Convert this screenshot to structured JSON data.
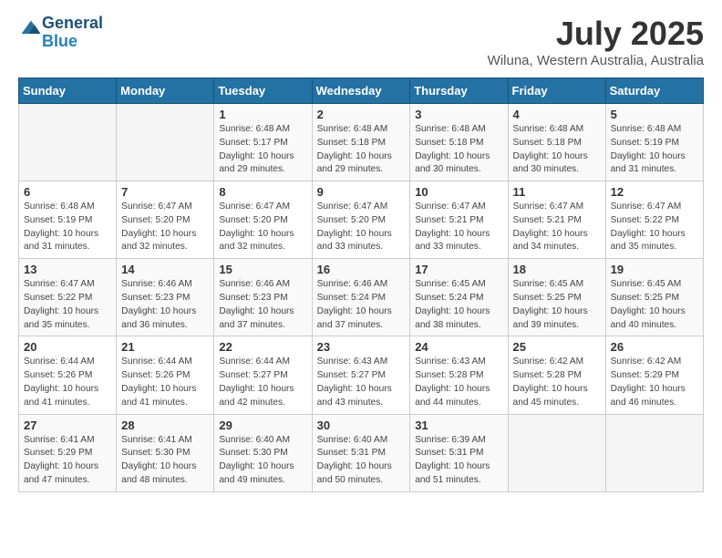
{
  "header": {
    "logo_line1": "General",
    "logo_line2": "Blue",
    "title": "July 2025",
    "subtitle": "Wiluna, Western Australia, Australia"
  },
  "weekdays": [
    "Sunday",
    "Monday",
    "Tuesday",
    "Wednesday",
    "Thursday",
    "Friday",
    "Saturday"
  ],
  "weeks": [
    [
      {
        "day": "",
        "info": ""
      },
      {
        "day": "",
        "info": ""
      },
      {
        "day": "1",
        "info": "Sunrise: 6:48 AM\nSunset: 5:17 PM\nDaylight: 10 hours\nand 29 minutes."
      },
      {
        "day": "2",
        "info": "Sunrise: 6:48 AM\nSunset: 5:18 PM\nDaylight: 10 hours\nand 29 minutes."
      },
      {
        "day": "3",
        "info": "Sunrise: 6:48 AM\nSunset: 5:18 PM\nDaylight: 10 hours\nand 30 minutes."
      },
      {
        "day": "4",
        "info": "Sunrise: 6:48 AM\nSunset: 5:18 PM\nDaylight: 10 hours\nand 30 minutes."
      },
      {
        "day": "5",
        "info": "Sunrise: 6:48 AM\nSunset: 5:19 PM\nDaylight: 10 hours\nand 31 minutes."
      }
    ],
    [
      {
        "day": "6",
        "info": "Sunrise: 6:48 AM\nSunset: 5:19 PM\nDaylight: 10 hours\nand 31 minutes."
      },
      {
        "day": "7",
        "info": "Sunrise: 6:47 AM\nSunset: 5:20 PM\nDaylight: 10 hours\nand 32 minutes."
      },
      {
        "day": "8",
        "info": "Sunrise: 6:47 AM\nSunset: 5:20 PM\nDaylight: 10 hours\nand 32 minutes."
      },
      {
        "day": "9",
        "info": "Sunrise: 6:47 AM\nSunset: 5:20 PM\nDaylight: 10 hours\nand 33 minutes."
      },
      {
        "day": "10",
        "info": "Sunrise: 6:47 AM\nSunset: 5:21 PM\nDaylight: 10 hours\nand 33 minutes."
      },
      {
        "day": "11",
        "info": "Sunrise: 6:47 AM\nSunset: 5:21 PM\nDaylight: 10 hours\nand 34 minutes."
      },
      {
        "day": "12",
        "info": "Sunrise: 6:47 AM\nSunset: 5:22 PM\nDaylight: 10 hours\nand 35 minutes."
      }
    ],
    [
      {
        "day": "13",
        "info": "Sunrise: 6:47 AM\nSunset: 5:22 PM\nDaylight: 10 hours\nand 35 minutes."
      },
      {
        "day": "14",
        "info": "Sunrise: 6:46 AM\nSunset: 5:23 PM\nDaylight: 10 hours\nand 36 minutes."
      },
      {
        "day": "15",
        "info": "Sunrise: 6:46 AM\nSunset: 5:23 PM\nDaylight: 10 hours\nand 37 minutes."
      },
      {
        "day": "16",
        "info": "Sunrise: 6:46 AM\nSunset: 5:24 PM\nDaylight: 10 hours\nand 37 minutes."
      },
      {
        "day": "17",
        "info": "Sunrise: 6:45 AM\nSunset: 5:24 PM\nDaylight: 10 hours\nand 38 minutes."
      },
      {
        "day": "18",
        "info": "Sunrise: 6:45 AM\nSunset: 5:25 PM\nDaylight: 10 hours\nand 39 minutes."
      },
      {
        "day": "19",
        "info": "Sunrise: 6:45 AM\nSunset: 5:25 PM\nDaylight: 10 hours\nand 40 minutes."
      }
    ],
    [
      {
        "day": "20",
        "info": "Sunrise: 6:44 AM\nSunset: 5:26 PM\nDaylight: 10 hours\nand 41 minutes."
      },
      {
        "day": "21",
        "info": "Sunrise: 6:44 AM\nSunset: 5:26 PM\nDaylight: 10 hours\nand 41 minutes."
      },
      {
        "day": "22",
        "info": "Sunrise: 6:44 AM\nSunset: 5:27 PM\nDaylight: 10 hours\nand 42 minutes."
      },
      {
        "day": "23",
        "info": "Sunrise: 6:43 AM\nSunset: 5:27 PM\nDaylight: 10 hours\nand 43 minutes."
      },
      {
        "day": "24",
        "info": "Sunrise: 6:43 AM\nSunset: 5:28 PM\nDaylight: 10 hours\nand 44 minutes."
      },
      {
        "day": "25",
        "info": "Sunrise: 6:42 AM\nSunset: 5:28 PM\nDaylight: 10 hours\nand 45 minutes."
      },
      {
        "day": "26",
        "info": "Sunrise: 6:42 AM\nSunset: 5:29 PM\nDaylight: 10 hours\nand 46 minutes."
      }
    ],
    [
      {
        "day": "27",
        "info": "Sunrise: 6:41 AM\nSunset: 5:29 PM\nDaylight: 10 hours\nand 47 minutes."
      },
      {
        "day": "28",
        "info": "Sunrise: 6:41 AM\nSunset: 5:30 PM\nDaylight: 10 hours\nand 48 minutes."
      },
      {
        "day": "29",
        "info": "Sunrise: 6:40 AM\nSunset: 5:30 PM\nDaylight: 10 hours\nand 49 minutes."
      },
      {
        "day": "30",
        "info": "Sunrise: 6:40 AM\nSunset: 5:31 PM\nDaylight: 10 hours\nand 50 minutes."
      },
      {
        "day": "31",
        "info": "Sunrise: 6:39 AM\nSunset: 5:31 PM\nDaylight: 10 hours\nand 51 minutes."
      },
      {
        "day": "",
        "info": ""
      },
      {
        "day": "",
        "info": ""
      }
    ]
  ]
}
